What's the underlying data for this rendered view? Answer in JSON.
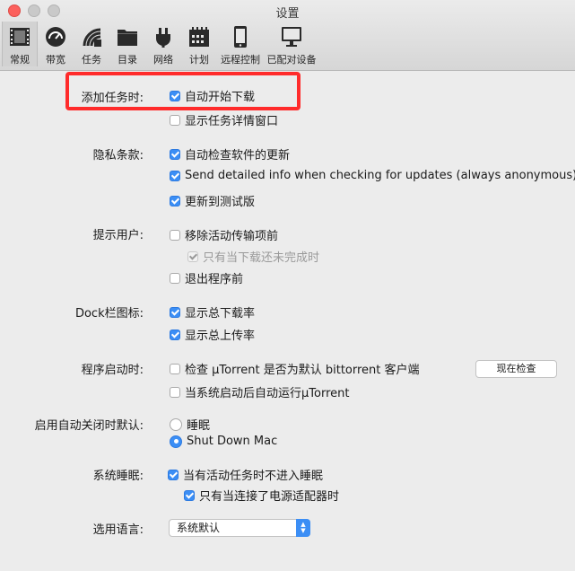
{
  "window": {
    "title": "设置"
  },
  "toolbar": {
    "items": [
      {
        "label": "常规",
        "icon": "film-icon"
      },
      {
        "label": "带宽",
        "icon": "gauge-icon"
      },
      {
        "label": "任务",
        "icon": "utorrent-icon"
      },
      {
        "label": "目录",
        "icon": "folder-icon"
      },
      {
        "label": "网络",
        "icon": "plug-icon"
      },
      {
        "label": "计划",
        "icon": "calendar-icon"
      },
      {
        "label": "远程控制",
        "icon": "phone-icon"
      },
      {
        "label": "已配对设备",
        "icon": "monitor-icon"
      }
    ]
  },
  "sections": {
    "add_task": {
      "label": "添加任务时:",
      "opt1": "自动开始下载",
      "opt2": "显示任务详情窗口"
    },
    "privacy": {
      "label": "隐私条款:",
      "opt1": "自动检查软件的更新",
      "opt2": "Send detailed info when checking for updates (always anonymous)",
      "opt3": "更新到测试版"
    },
    "notify": {
      "label": "提示用户:",
      "opt1": "移除活动传输项前",
      "opt2": "只有当下载还未完成时",
      "opt3": "退出程序前"
    },
    "dock": {
      "label": "Dock栏图标:",
      "opt1": "显示总下载率",
      "opt2": "显示总上传率"
    },
    "startup": {
      "label": "程序启动时:",
      "opt1": "检查 µTorrent 是否为默认 bittorrent 客户端",
      "opt2": "当系统启动后自动运行µTorrent",
      "check_now_button": "现在检查"
    },
    "auto_shutdown": {
      "label": "启用自动关闭时默认:",
      "opt1": "睡眠",
      "opt2": "Shut Down Mac"
    },
    "sleep": {
      "label": "系统睡眠:",
      "opt1": "当有活动任务时不进入睡眠",
      "opt2": "只有当连接了电源适配器时"
    },
    "language": {
      "label": "选用语言:",
      "selected": "系统默认"
    }
  },
  "colors": {
    "accent": "#3b8ef5",
    "highlight": "#ff2b2b"
  }
}
